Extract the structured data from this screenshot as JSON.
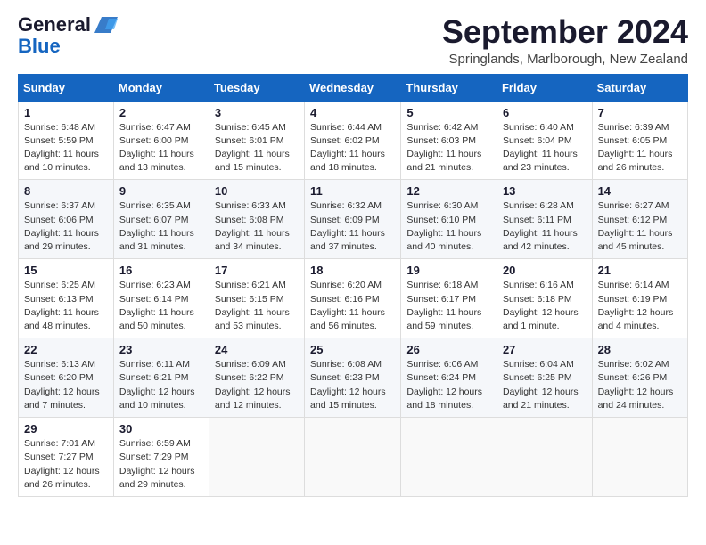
{
  "header": {
    "logo_general": "General",
    "logo_blue": "Blue",
    "month_title": "September 2024",
    "location": "Springlands, Marlborough, New Zealand"
  },
  "weekdays": [
    "Sunday",
    "Monday",
    "Tuesday",
    "Wednesday",
    "Thursday",
    "Friday",
    "Saturday"
  ],
  "weeks": [
    [
      {
        "day": "1",
        "sunrise": "6:48 AM",
        "sunset": "5:59 PM",
        "daylight": "11 hours and 10 minutes."
      },
      {
        "day": "2",
        "sunrise": "6:47 AM",
        "sunset": "6:00 PM",
        "daylight": "11 hours and 13 minutes."
      },
      {
        "day": "3",
        "sunrise": "6:45 AM",
        "sunset": "6:01 PM",
        "daylight": "11 hours and 15 minutes."
      },
      {
        "day": "4",
        "sunrise": "6:44 AM",
        "sunset": "6:02 PM",
        "daylight": "11 hours and 18 minutes."
      },
      {
        "day": "5",
        "sunrise": "6:42 AM",
        "sunset": "6:03 PM",
        "daylight": "11 hours and 21 minutes."
      },
      {
        "day": "6",
        "sunrise": "6:40 AM",
        "sunset": "6:04 PM",
        "daylight": "11 hours and 23 minutes."
      },
      {
        "day": "7",
        "sunrise": "6:39 AM",
        "sunset": "6:05 PM",
        "daylight": "11 hours and 26 minutes."
      }
    ],
    [
      {
        "day": "8",
        "sunrise": "6:37 AM",
        "sunset": "6:06 PM",
        "daylight": "11 hours and 29 minutes."
      },
      {
        "day": "9",
        "sunrise": "6:35 AM",
        "sunset": "6:07 PM",
        "daylight": "11 hours and 31 minutes."
      },
      {
        "day": "10",
        "sunrise": "6:33 AM",
        "sunset": "6:08 PM",
        "daylight": "11 hours and 34 minutes."
      },
      {
        "day": "11",
        "sunrise": "6:32 AM",
        "sunset": "6:09 PM",
        "daylight": "11 hours and 37 minutes."
      },
      {
        "day": "12",
        "sunrise": "6:30 AM",
        "sunset": "6:10 PM",
        "daylight": "11 hours and 40 minutes."
      },
      {
        "day": "13",
        "sunrise": "6:28 AM",
        "sunset": "6:11 PM",
        "daylight": "11 hours and 42 minutes."
      },
      {
        "day": "14",
        "sunrise": "6:27 AM",
        "sunset": "6:12 PM",
        "daylight": "11 hours and 45 minutes."
      }
    ],
    [
      {
        "day": "15",
        "sunrise": "6:25 AM",
        "sunset": "6:13 PM",
        "daylight": "11 hours and 48 minutes."
      },
      {
        "day": "16",
        "sunrise": "6:23 AM",
        "sunset": "6:14 PM",
        "daylight": "11 hours and 50 minutes."
      },
      {
        "day": "17",
        "sunrise": "6:21 AM",
        "sunset": "6:15 PM",
        "daylight": "11 hours and 53 minutes."
      },
      {
        "day": "18",
        "sunrise": "6:20 AM",
        "sunset": "6:16 PM",
        "daylight": "11 hours and 56 minutes."
      },
      {
        "day": "19",
        "sunrise": "6:18 AM",
        "sunset": "6:17 PM",
        "daylight": "11 hours and 59 minutes."
      },
      {
        "day": "20",
        "sunrise": "6:16 AM",
        "sunset": "6:18 PM",
        "daylight": "12 hours and 1 minute."
      },
      {
        "day": "21",
        "sunrise": "6:14 AM",
        "sunset": "6:19 PM",
        "daylight": "12 hours and 4 minutes."
      }
    ],
    [
      {
        "day": "22",
        "sunrise": "6:13 AM",
        "sunset": "6:20 PM",
        "daylight": "12 hours and 7 minutes."
      },
      {
        "day": "23",
        "sunrise": "6:11 AM",
        "sunset": "6:21 PM",
        "daylight": "12 hours and 10 minutes."
      },
      {
        "day": "24",
        "sunrise": "6:09 AM",
        "sunset": "6:22 PM",
        "daylight": "12 hours and 12 minutes."
      },
      {
        "day": "25",
        "sunrise": "6:08 AM",
        "sunset": "6:23 PM",
        "daylight": "12 hours and 15 minutes."
      },
      {
        "day": "26",
        "sunrise": "6:06 AM",
        "sunset": "6:24 PM",
        "daylight": "12 hours and 18 minutes."
      },
      {
        "day": "27",
        "sunrise": "6:04 AM",
        "sunset": "6:25 PM",
        "daylight": "12 hours and 21 minutes."
      },
      {
        "day": "28",
        "sunrise": "6:02 AM",
        "sunset": "6:26 PM",
        "daylight": "12 hours and 24 minutes."
      }
    ],
    [
      {
        "day": "29",
        "sunrise": "7:01 AM",
        "sunset": "7:27 PM",
        "daylight": "12 hours and 26 minutes."
      },
      {
        "day": "30",
        "sunrise": "6:59 AM",
        "sunset": "7:29 PM",
        "daylight": "12 hours and 29 minutes."
      },
      null,
      null,
      null,
      null,
      null
    ]
  ]
}
